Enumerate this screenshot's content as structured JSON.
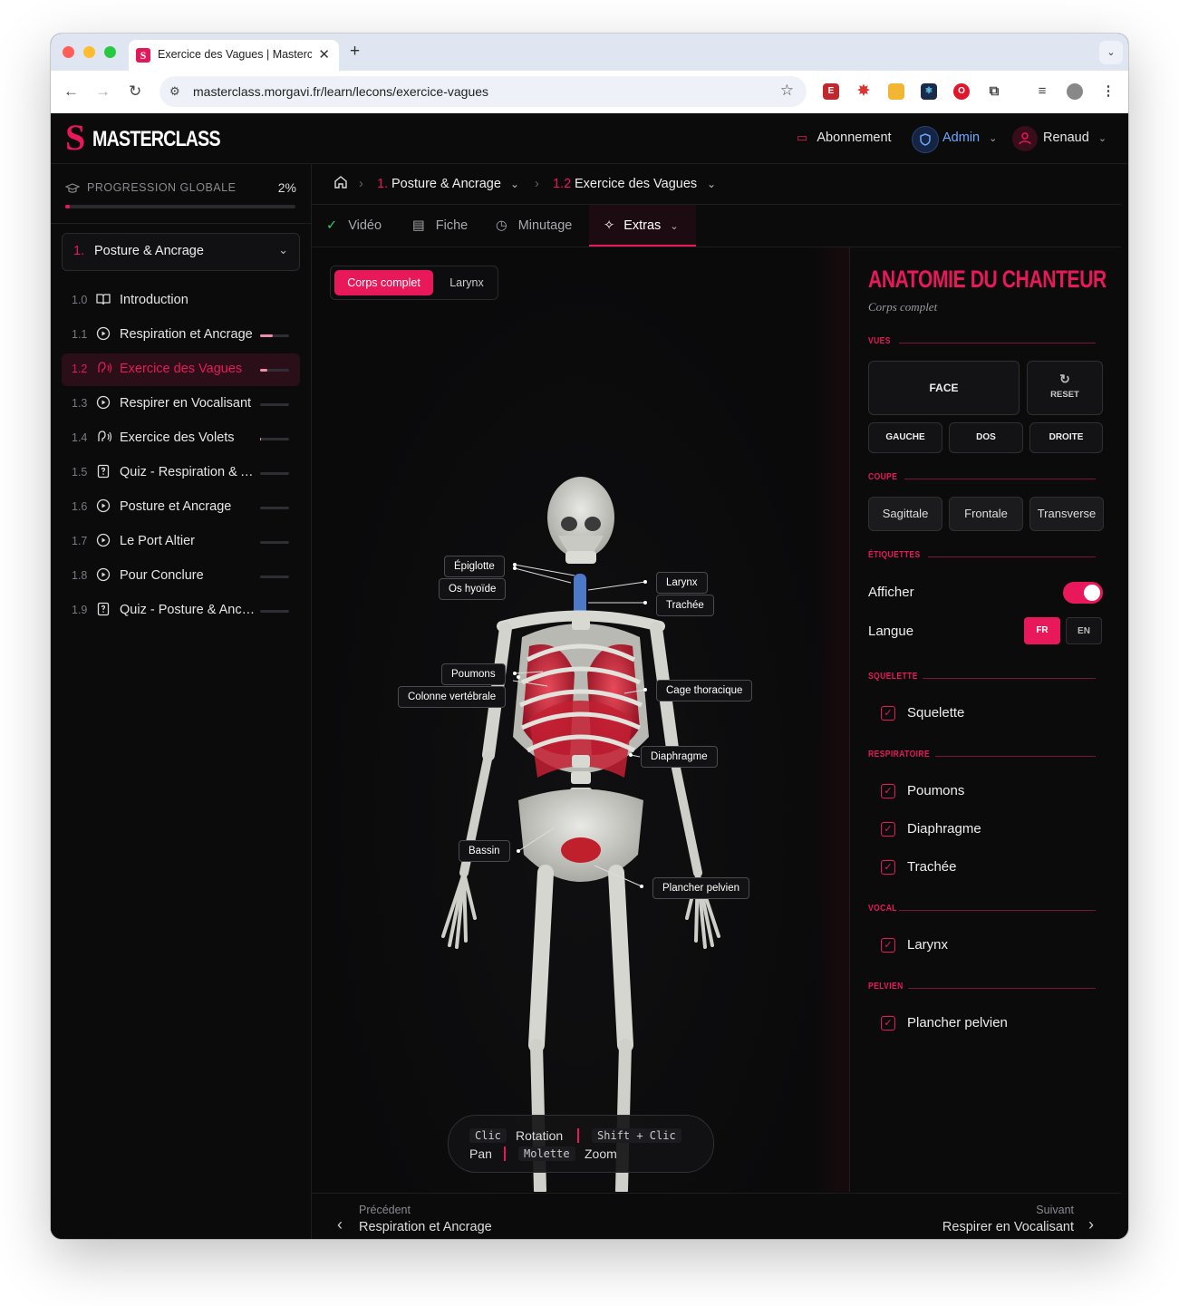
{
  "browser": {
    "tab_title": "Exercice des Vagues | Masterclass",
    "url": "masterclass.morgavi.fr/learn/lecons/exercice-vagues"
  },
  "header": {
    "logo_letter": "S",
    "logo_text": "MASTERCLASS",
    "subscription": "Abonnement",
    "admin": "Admin",
    "user": "Renaud"
  },
  "sidebar": {
    "progress_label": "PROGRESSION GLOBALE",
    "progress_pct": "2%",
    "progress_value": 0.02,
    "module_number": "1.",
    "module_name": "Posture & Ancrage",
    "lessons": [
      {
        "num": "1.0",
        "title": "Introduction",
        "icon": "book-icon",
        "progress": null,
        "active": false
      },
      {
        "num": "1.1",
        "title": "Respiration et Ancrage",
        "icon": "play-circle-icon",
        "progress": 0.45,
        "active": false
      },
      {
        "num": "1.2",
        "title": "Exercice des Vagues",
        "icon": "audio-wave-icon",
        "progress": 0.25,
        "active": true
      },
      {
        "num": "1.3",
        "title": "Respirer en Vocalisant",
        "icon": "play-circle-icon",
        "progress": 0,
        "active": false
      },
      {
        "num": "1.4",
        "title": "Exercice des Volets",
        "icon": "audio-wave-icon",
        "progress": 0.02,
        "active": false
      },
      {
        "num": "1.5",
        "title": "Quiz - Respiration & Ancrage",
        "icon": "quiz-icon",
        "progress": 0,
        "active": false
      },
      {
        "num": "1.6",
        "title": "Posture et Ancrage",
        "icon": "play-circle-icon",
        "progress": 0,
        "active": false
      },
      {
        "num": "1.7",
        "title": "Le Port Altier",
        "icon": "play-circle-icon",
        "progress": 0,
        "active": false
      },
      {
        "num": "1.8",
        "title": "Pour Conclure",
        "icon": "play-circle-icon",
        "progress": 0,
        "active": false
      },
      {
        "num": "1.9",
        "title": "Quiz - Posture & Ancrage",
        "icon": "quiz-icon",
        "progress": 0,
        "active": false
      }
    ]
  },
  "breadcrumb": {
    "module_num": "1.",
    "module": "Posture & Ancrage",
    "lesson_num": "1.2",
    "lesson": "Exercice des Vagues"
  },
  "tabs": [
    "Vidéo",
    "Fiche",
    "Minutage",
    "Extras"
  ],
  "viewer": {
    "toggle_on": "Corps complet",
    "toggle_off": "Larynx",
    "labels": {
      "epiglotte": "Épiglotte",
      "os_hyoide": "Os hyoïde",
      "larynx": "Larynx",
      "trachee": "Trachée",
      "poumons": "Poumons",
      "colonne": "Colonne vertébrale",
      "cage": "Cage thoracique",
      "diaphragme": "Diaphragme",
      "bassin": "Bassin",
      "plancher": "Plancher pelvien"
    },
    "controls": {
      "k1": "Clic",
      "a1": "Rotation",
      "k2": "Shift + Clic",
      "a2": "Pan",
      "k3": "Molette",
      "a3": "Zoom"
    }
  },
  "footer": {
    "prev_label": "Précédent",
    "prev_title": "Respiration et Ancrage",
    "next_label": "Suivant",
    "next_title": "Respirer en Vocalisant"
  },
  "panel": {
    "title": "ANATOMIE DU CHANTEUR",
    "subtitle": "Corps complet",
    "sections": {
      "vues": "VUES",
      "coupe": "COUPE",
      "etiquettes": "ÉTIQUETTES",
      "squelette": "SQUELETTE",
      "respiratoire": "RESPIRATOIRE",
      "vocal": "VOCAL",
      "pelvien": "PELVIEN"
    },
    "views": {
      "face": "FACE",
      "reset": "RESET",
      "gauche": "GAUCHE",
      "dos": "DOS",
      "droite": "DROITE"
    },
    "cuts": {
      "sagittale": "Sagittale",
      "frontale": "Frontale",
      "transverse": "Transverse"
    },
    "show_labels": "Afficher",
    "language": "Langue",
    "lang_fr": "FR",
    "lang_en": "EN",
    "items": {
      "squelette": "Squelette",
      "poumons": "Poumons",
      "diaphragme": "Diaphragme",
      "trachee": "Trachée",
      "larynx": "Larynx",
      "plancher": "Plancher pelvien"
    }
  },
  "colors": {
    "accent": "#e8185a",
    "background": "#0b0b0c",
    "admin": "#6aa9ff"
  }
}
